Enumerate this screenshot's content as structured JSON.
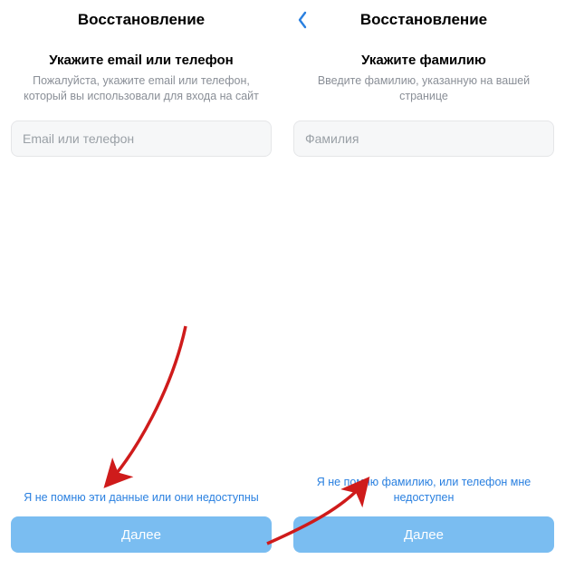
{
  "left": {
    "title": "Восстановление",
    "heading": "Укажите email или телефон",
    "subheading": "Пожалуйста, укажите email или телефон, который вы использовали для входа на сайт",
    "placeholder": "Email или телефон",
    "forgot": "Я не помню эти данные или они недоступны",
    "next": "Далее"
  },
  "right": {
    "title": "Восстановление",
    "heading": "Укажите фамилию",
    "subheading": "Введите фамилию, указанную на вашей странице",
    "placeholder": "Фамилия",
    "forgot": "Я не помню фамилию, или телефон мне недоступен",
    "next": "Далее"
  },
  "icons": {
    "back": "chevron-left"
  },
  "colors": {
    "accent": "#2a80e0",
    "button": "#7abdf1",
    "arrow": "#cf1b1b"
  }
}
